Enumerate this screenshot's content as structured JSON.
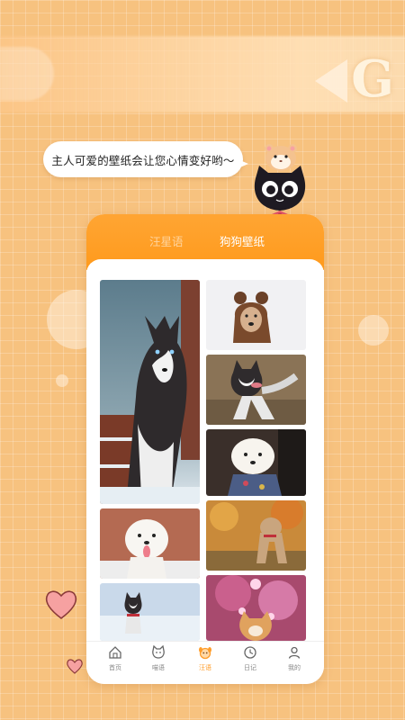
{
  "banner": {
    "speech_bubble": "主人可爱的壁纸会让您心情变好哟～"
  },
  "tabs": [
    {
      "label": "汪星语",
      "active": false
    },
    {
      "label": "狗狗壁纸",
      "active": true
    }
  ],
  "wallpapers": [
    {
      "subject": "husky-in-snow"
    },
    {
      "subject": "dog-in-bear-hat"
    },
    {
      "subject": "husky-on-dirt"
    },
    {
      "subject": "white-maltese-in-sweater"
    },
    {
      "subject": "white-puppy-tongue-out"
    },
    {
      "subject": "golden-dog-autumn"
    },
    {
      "subject": "husky-puppy-snow"
    },
    {
      "subject": "shiba-with-pink-lights"
    }
  ],
  "bottom_nav": [
    {
      "label": "首页",
      "icon": "home-icon",
      "active": false
    },
    {
      "label": "喵语",
      "icon": "cat-icon",
      "active": false
    },
    {
      "label": "汪语",
      "icon": "dog-icon",
      "active": true
    },
    {
      "label": "日记",
      "icon": "clock-icon",
      "active": false
    },
    {
      "label": "我的",
      "icon": "user-icon",
      "active": false
    }
  ],
  "colors": {
    "background": "#f7c27f",
    "accent": "#ff9d2a",
    "active_nav": "#ff9d2a"
  }
}
